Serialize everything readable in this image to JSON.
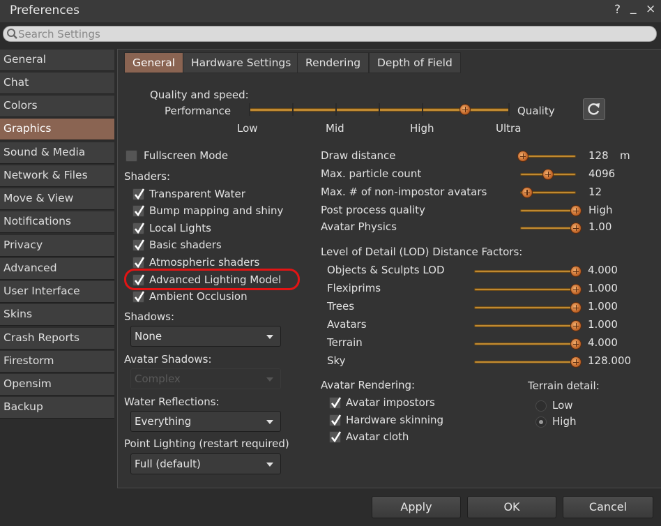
{
  "window": {
    "title": "Preferences",
    "help": "?",
    "minimize": "_",
    "close": "×"
  },
  "search": {
    "placeholder": "Search Settings"
  },
  "sidebar": {
    "items": [
      {
        "label": "General"
      },
      {
        "label": "Chat"
      },
      {
        "label": "Colors"
      },
      {
        "label": "Graphics",
        "active": true
      },
      {
        "label": "Sound & Media"
      },
      {
        "label": "Network & Files"
      },
      {
        "label": "Move & View"
      },
      {
        "label": "Notifications"
      },
      {
        "label": "Privacy"
      },
      {
        "label": "Advanced"
      },
      {
        "label": "User Interface"
      },
      {
        "label": "Skins"
      },
      {
        "label": "Crash Reports"
      },
      {
        "label": "Firestorm"
      },
      {
        "label": "Opensim"
      },
      {
        "label": "Backup"
      }
    ]
  },
  "tabs": [
    {
      "label": "General",
      "active": true
    },
    {
      "label": "Hardware Settings"
    },
    {
      "label": "Rendering"
    },
    {
      "label": "Depth of Field"
    }
  ],
  "quality": {
    "heading": "Quality and speed:",
    "left_label": "Performance",
    "right_label": "Quality",
    "ticks": [
      "Low",
      "Mid",
      "High",
      "Ultra"
    ],
    "value_fraction": 0.83
  },
  "fullscreen": {
    "label": "Fullscreen Mode",
    "checked": false
  },
  "shaders": {
    "heading": "Shaders:",
    "items": [
      {
        "label": "Transparent Water",
        "checked": true
      },
      {
        "label": "Bump mapping and shiny",
        "checked": true
      },
      {
        "label": "Local Lights",
        "checked": true
      },
      {
        "label": "Basic shaders",
        "checked": true
      },
      {
        "label": "Atmospheric shaders",
        "checked": true
      },
      {
        "label": "Advanced Lighting Model",
        "checked": true
      },
      {
        "label": "Ambient Occlusion",
        "checked": true
      }
    ]
  },
  "shadows": {
    "label": "Shadows:",
    "value": "None"
  },
  "avatar_shadows": {
    "label": "Avatar Shadows:",
    "value": "Complex",
    "disabled": true
  },
  "water_reflections": {
    "label": "Water Reflections:",
    "value": "Everything"
  },
  "point_lighting": {
    "label": "Point Lighting (restart required)",
    "value": "Full (default)"
  },
  "right_sliders": [
    {
      "label": "Draw distance",
      "value": "128",
      "unit": "m",
      "fraction": 0.05
    },
    {
      "label": "Max. particle count",
      "value": "4096",
      "fraction": 0.5
    },
    {
      "label": "Max. # of non-impostor avatars",
      "value": "12",
      "fraction": 0.12
    },
    {
      "label": "Post process quality",
      "value": "High",
      "fraction": 1.0
    },
    {
      "label": "Avatar Physics",
      "value": "1.00",
      "fraction": 1.0
    }
  ],
  "lod": {
    "heading": "Level of Detail (LOD) Distance Factors:",
    "items": [
      {
        "label": "Objects & Sculpts LOD",
        "value": "4.000",
        "fraction": 1.0
      },
      {
        "label": "Flexiprims",
        "value": "1.000",
        "fraction": 1.0
      },
      {
        "label": "Trees",
        "value": "1.000",
        "fraction": 1.0
      },
      {
        "label": "Avatars",
        "value": "1.000",
        "fraction": 1.0
      },
      {
        "label": "Terrain",
        "value": "4.000",
        "fraction": 1.0
      },
      {
        "label": "Sky",
        "value": "128.000",
        "fraction": 1.0
      }
    ]
  },
  "avatar_rendering": {
    "heading": "Avatar Rendering:",
    "items": [
      {
        "label": "Avatar impostors",
        "checked": true
      },
      {
        "label": "Hardware skinning",
        "checked": true
      },
      {
        "label": "Avatar cloth",
        "checked": true
      }
    ]
  },
  "terrain_detail": {
    "heading": "Terrain detail:",
    "options": [
      {
        "label": "Low",
        "selected": false
      },
      {
        "label": "High",
        "selected": true
      }
    ]
  },
  "buttons": {
    "apply": "Apply",
    "ok": "OK",
    "cancel": "Cancel"
  },
  "colors": {
    "accent": "#8a6452",
    "slider": "#c08a32",
    "highlight": "#e21414"
  }
}
